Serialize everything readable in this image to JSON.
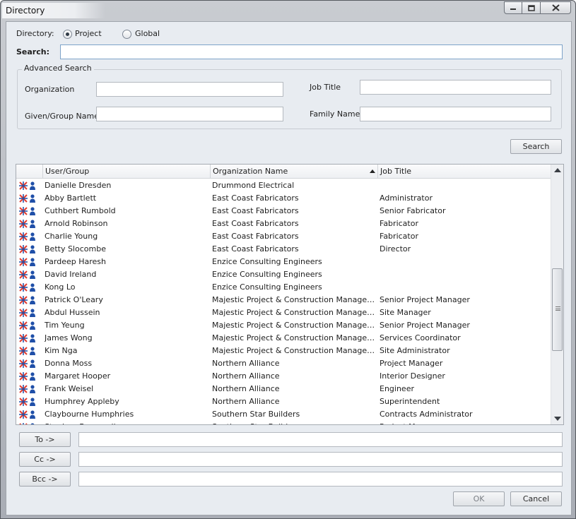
{
  "window": {
    "title": "Directory"
  },
  "directory": {
    "label": "Directory:",
    "options": [
      "Project",
      "Global"
    ],
    "selected": "Project"
  },
  "search": {
    "label": "Search:",
    "value": ""
  },
  "advanced": {
    "caption": "Advanced Search",
    "organization_label": "Organization",
    "job_title_label": "Job Title",
    "given_name_label": "Given/Group Name",
    "family_name_label": "Family Name"
  },
  "search_button": "Search",
  "grid": {
    "columns": [
      "User/Group",
      "Organization Name",
      "Job Title"
    ],
    "sort": {
      "column": "Organization Name",
      "direction": "ascending"
    },
    "rows": [
      {
        "name": "Danielle Dresden",
        "org": "Drummond Electrical",
        "title": ""
      },
      {
        "name": "Abby Bartlett",
        "org": "East Coast Fabricators",
        "title": "Administrator"
      },
      {
        "name": "Cuthbert Rumbold",
        "org": "East Coast Fabricators",
        "title": "Senior Fabricator"
      },
      {
        "name": "Arnold Robinson",
        "org": "East Coast Fabricators",
        "title": "Fabricator"
      },
      {
        "name": "Charlie Young",
        "org": "East Coast Fabricators",
        "title": "Fabricator"
      },
      {
        "name": "Betty Slocombe",
        "org": "East Coast Fabricators",
        "title": "Director"
      },
      {
        "name": "Pardeep Haresh",
        "org": "Enzice Consulting Engineers",
        "title": ""
      },
      {
        "name": "David Ireland",
        "org": "Enzice Consulting Engineers",
        "title": ""
      },
      {
        "name": "Kong Lo",
        "org": "Enzice Consulting Engineers",
        "title": ""
      },
      {
        "name": "Patrick O'Leary",
        "org": "Majestic Project & Construction Management ...",
        "title": "Senior Project Manager"
      },
      {
        "name": "Abdul Hussein",
        "org": "Majestic Project & Construction Management ...",
        "title": "Site Manager"
      },
      {
        "name": "Tim Yeung",
        "org": "Majestic Project & Construction Management ...",
        "title": "Senior Project Manager"
      },
      {
        "name": "James Wong",
        "org": "Majestic Project & Construction Management ...",
        "title": "Services Coordinator"
      },
      {
        "name": "Kim Nga",
        "org": "Majestic Project & Construction Management ...",
        "title": "Site Administrator"
      },
      {
        "name": "Donna Moss",
        "org": "Northern Alliance",
        "title": "Project Manager"
      },
      {
        "name": "Margaret Hooper",
        "org": "Northern Alliance",
        "title": "Interior Designer"
      },
      {
        "name": "Frank Weisel",
        "org": "Northern Alliance",
        "title": "Engineer"
      },
      {
        "name": "Humphrey Appleby",
        "org": "Northern Alliance",
        "title": "Superintendent"
      },
      {
        "name": "Claybourne Humphries",
        "org": "Southern Star Builders",
        "title": "Contracts Administrator"
      },
      {
        "name": "Stephen Bramwell",
        "org": "Southern Star Builders",
        "title": "Project Manager"
      }
    ]
  },
  "recipients": {
    "to_label": "To ->",
    "to_value": "",
    "cc_label": "Cc ->",
    "cc_value": "",
    "bcc_label": "Bcc ->",
    "bcc_value": ""
  },
  "footer": {
    "ok": "OK",
    "cancel": "Cancel"
  },
  "colors": {
    "accent_red": "#e23b2e",
    "accent_blue": "#1f4fa8",
    "focus_border": "#7ea3c9"
  }
}
